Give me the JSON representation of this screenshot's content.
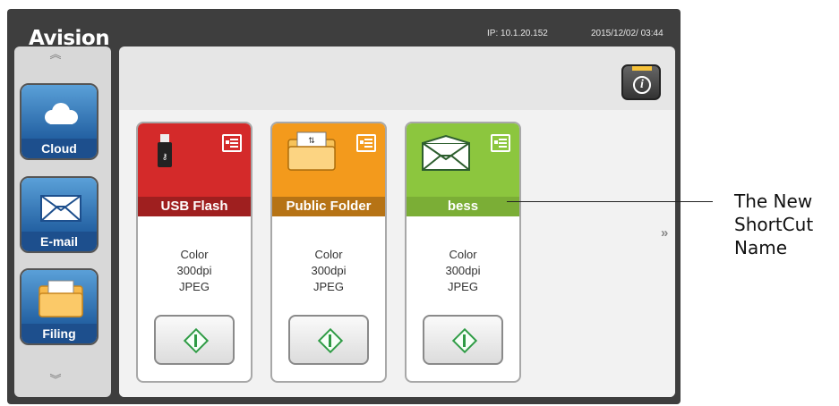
{
  "header": {
    "brand": "Avision",
    "ip": "IP: 10.1.20.152",
    "datetime": "2015/12/02/ 03:44"
  },
  "sidebar": {
    "items": [
      {
        "label": "Cloud",
        "icon": "cloud-icon"
      },
      {
        "label": "E-mail",
        "icon": "envelope-icon"
      },
      {
        "label": "Filing",
        "icon": "folder-icon"
      }
    ],
    "scroll_up_icon": "double-chevron-up-icon",
    "scroll_down_icon": "double-chevron-down-icon"
  },
  "toolbar": {
    "info_icon": "info-icon",
    "next_page_label": "»"
  },
  "shortcuts": [
    {
      "name": "USB Flash",
      "color": "#d42a2a",
      "icon": "usb-icon",
      "color_mode": "Color",
      "resolution": "300dpi",
      "format": "JPEG"
    },
    {
      "name": "Public Folder",
      "color": "#f39a1c",
      "icon": "folder-icon",
      "color_mode": "Color",
      "resolution": "300dpi",
      "format": "JPEG"
    },
    {
      "name": "bess",
      "color": "#8cc63e",
      "icon": "envelope-icon",
      "color_mode": "Color",
      "resolution": "300dpi",
      "format": "JPEG"
    }
  ],
  "annotation": {
    "line1": "The New",
    "line2": "ShortCut",
    "line3": "Name"
  }
}
